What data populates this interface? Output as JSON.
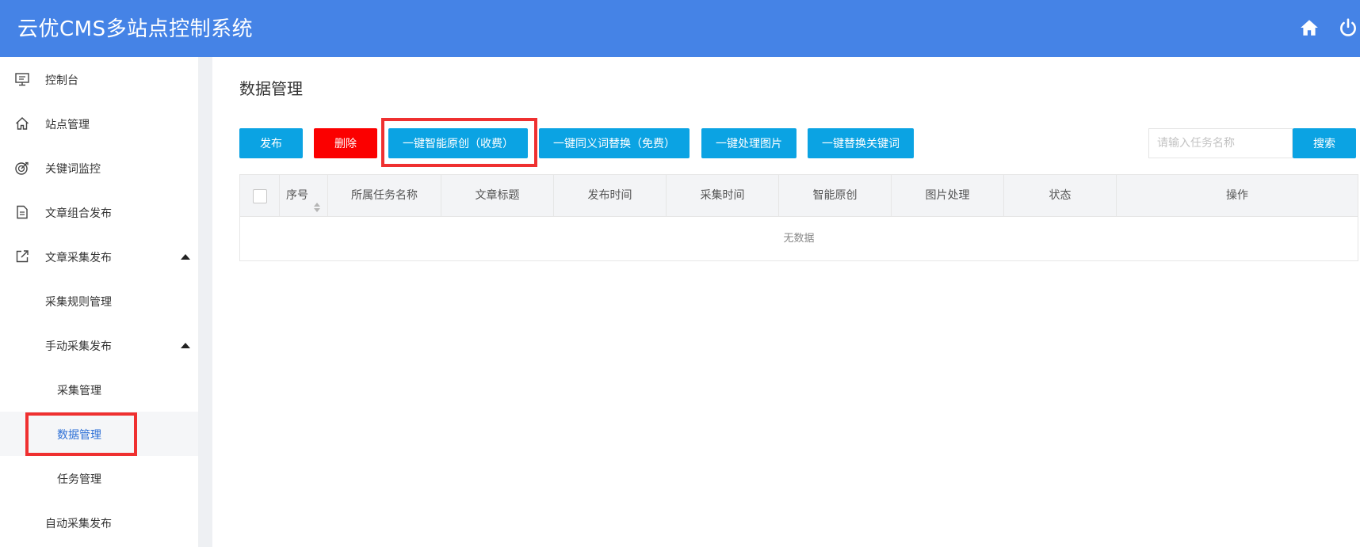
{
  "header": {
    "app_title": "云优CMS多站点控制系统",
    "icons": [
      "home-icon",
      "power-icon"
    ]
  },
  "sidebar": {
    "items": [
      {
        "label": "控制台",
        "icon": "monitor-icon"
      },
      {
        "label": "站点管理",
        "icon": "home-icon"
      },
      {
        "label": "关键词监控",
        "icon": "target-icon"
      },
      {
        "label": "文章组合发布",
        "icon": "document-icon"
      },
      {
        "label": "文章采集发布",
        "icon": "external-link-icon",
        "expanded": true
      },
      {
        "label": "采集规则管理"
      },
      {
        "label": "手动采集发布",
        "expanded": true
      },
      {
        "label": "采集管理"
      },
      {
        "label": "数据管理",
        "active": true
      },
      {
        "label": "任务管理"
      },
      {
        "label": "自动采集发布"
      }
    ]
  },
  "main": {
    "page_title": "数据管理",
    "toolbar": {
      "publish": "发布",
      "delete": "删除",
      "smart_original": "一键智能原创（收费）",
      "synonym_replace": "一键同义词替换（免费）",
      "process_images": "一键处理图片",
      "replace_keywords": "一键替换关键词",
      "search_placeholder": "请输入任务名称",
      "search_button": "搜索"
    },
    "table": {
      "columns": [
        "序号",
        "所属任务名称",
        "文章标题",
        "发布时间",
        "采集时间",
        "智能原创",
        "图片处理",
        "状态",
        "操作"
      ],
      "empty_text": "无数据",
      "rows": []
    }
  },
  "colors": {
    "header": "#4583e6",
    "primary_button": "#0ba3e3",
    "danger_button": "#fb0000",
    "highlight_border": "#ef3030",
    "active_nav_text": "#2c6fd6"
  }
}
